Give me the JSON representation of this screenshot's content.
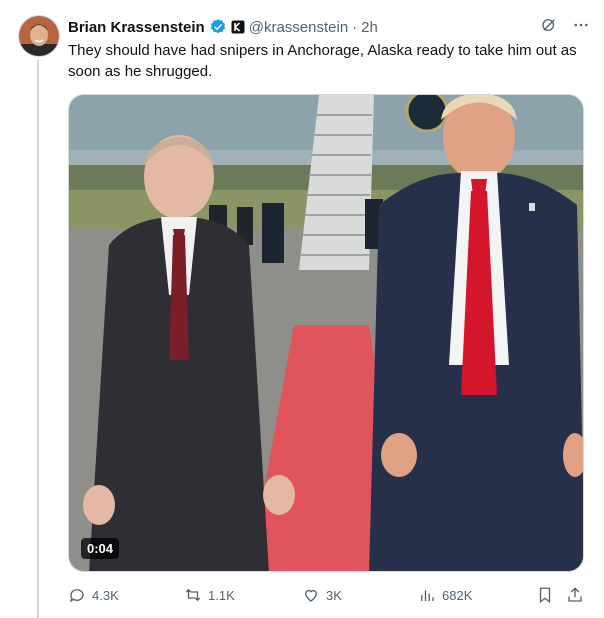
{
  "tweet": {
    "author_name": "Brian Krassenstein",
    "handle": "@krassenstein",
    "separator": "·",
    "time": "2h",
    "text": "They should have had snipers in Anchorage, Alaska ready to take him out as soon as he shrugged."
  },
  "media": {
    "duration": "0:04"
  },
  "actions": {
    "replies": "4.3K",
    "reposts": "1.1K",
    "likes": "3K",
    "views": "682K"
  },
  "colors": {
    "verified_blue": "#1d9bf0",
    "secondary_text": "#536471",
    "carpet_red": "#e0545b"
  }
}
